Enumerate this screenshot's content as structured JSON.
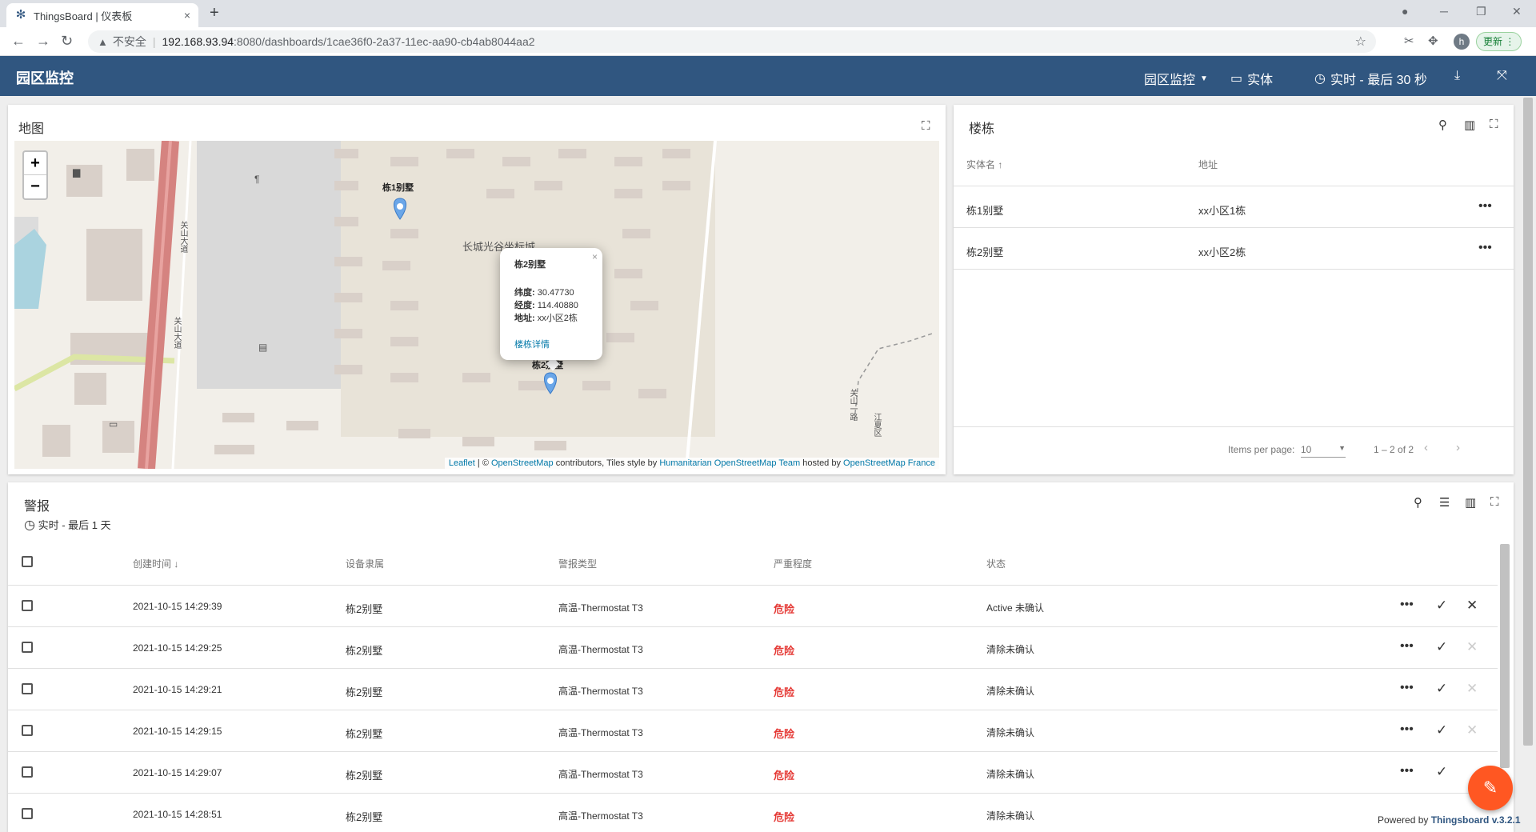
{
  "browser": {
    "tab_title": "ThingsBoard | 仪表板",
    "tab_close": "×",
    "new_tab": "+",
    "insecure_label": "不安全",
    "url_host": "192.168.93.94",
    "url_rest": ":8080/dashboards/1cae36f0-2a37-11ec-aa90-cb4ab8044aa2",
    "profile_initial": "h",
    "update_label": "更新"
  },
  "toolbar": {
    "title": "园区监控",
    "dashboard_select": "园区监控",
    "entities_label": "实体",
    "timewindow_label": "实时 - 最后 30 秒"
  },
  "map_card": {
    "title": "地图",
    "zoom_in": "+",
    "zoom_out": "−",
    "label_b1": "栋1别墅",
    "label_b2": "栋2别墅",
    "area_label": "长城光谷坐标城",
    "road_label": "关山大道",
    "road_label2": "关山大道",
    "side_label1": "关山一路",
    "side_label2": "江夏区",
    "popup": {
      "title": "栋2别墅",
      "lat_key": "纬度:",
      "lat_val": "30.47730",
      "lng_key": "经度:",
      "lng_val": "114.40880",
      "addr_key": "地址:",
      "addr_val": "xx小区2栋",
      "link": "楼栋详情",
      "close": "×"
    },
    "attribution": {
      "leaflet": "Leaflet",
      "sep1": " | © ",
      "osm": "OpenStreetMap",
      "mid": " contributors, Tiles style by ",
      "hot": "Humanitarian OpenStreetMap Team",
      "hosted": " hosted by ",
      "osmfr": "OpenStreetMap France"
    }
  },
  "buildings_card": {
    "title": "楼栋",
    "col_name": "实体名 ↑",
    "col_address": "地址",
    "rows": [
      {
        "name": "栋1别墅",
        "address": "xx小区1栋"
      },
      {
        "name": "栋2别墅",
        "address": "xx小区2栋"
      }
    ],
    "items_per_page_label": "Items per page:",
    "items_per_page_value": "10",
    "range": "1 – 2 of 2"
  },
  "alarms_card": {
    "title": "警报",
    "timewindow": "实时 - 最后 1 天",
    "col_created": "创建时间 ↓",
    "col_originator": "设备隶属",
    "col_type": "警报类型",
    "col_severity": "严重程度",
    "col_status": "状态",
    "rows": [
      {
        "time": "2021-10-15 14:29:39",
        "originator": "栋2别墅",
        "type": "高温-Thermostat T3",
        "severity": "危险",
        "status": "Active 未确认"
      },
      {
        "time": "2021-10-15 14:29:25",
        "originator": "栋2别墅",
        "type": "高温-Thermostat T3",
        "severity": "危险",
        "status": "清除未确认"
      },
      {
        "time": "2021-10-15 14:29:21",
        "originator": "栋2别墅",
        "type": "高温-Thermostat T3",
        "severity": "危险",
        "status": "清除未确认"
      },
      {
        "time": "2021-10-15 14:29:15",
        "originator": "栋2别墅",
        "type": "高温-Thermostat T3",
        "severity": "危险",
        "status": "清除未确认"
      },
      {
        "time": "2021-10-15 14:29:07",
        "originator": "栋2别墅",
        "type": "高温-Thermostat T3",
        "severity": "危险",
        "status": "清除未确认"
      },
      {
        "time": "2021-10-15 14:28:51",
        "originator": "栋2别墅",
        "type": "高温-Thermostat T3",
        "severity": "危险",
        "status": "清除未确认"
      }
    ]
  },
  "footer": {
    "powered_by": "Powered by ",
    "brand": "Thingsboard v.3.2.1"
  },
  "colors": {
    "primary": "#305680",
    "danger": "#e53935",
    "fab": "#ff5722"
  }
}
